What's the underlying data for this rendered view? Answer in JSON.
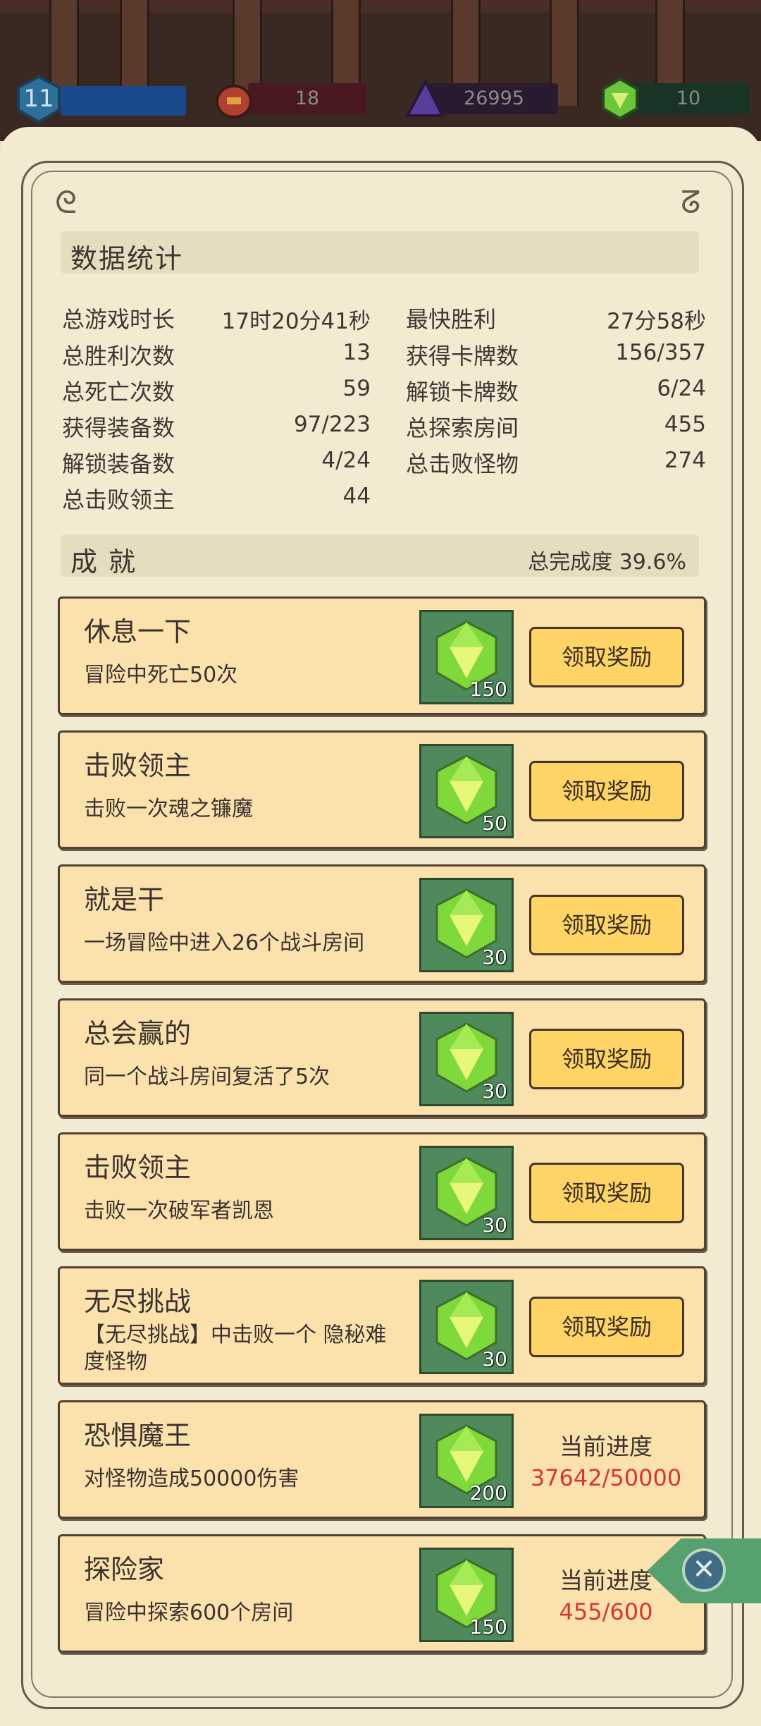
{
  "header": {
    "level": "11",
    "resources": [
      {
        "icon": "potion-icon",
        "value": "18",
        "bar_color": "#4a1820"
      },
      {
        "icon": "purple-crystal-icon",
        "value": "26995",
        "bar_color": "#2a1a30"
      },
      {
        "icon": "green-gem-icon",
        "value": "10",
        "bar_color": "#183424"
      }
    ]
  },
  "stats": {
    "title": "数据统计",
    "left": [
      {
        "label": "总游戏时长",
        "value": "17时20分41秒"
      },
      {
        "label": "总胜利次数",
        "value": "13"
      },
      {
        "label": "总死亡次数",
        "value": "59"
      },
      {
        "label": "获得装备数",
        "value": "97/223"
      },
      {
        "label": "解锁装备数",
        "value": "4/24"
      },
      {
        "label": "总击败领主",
        "value": "44"
      }
    ],
    "right": [
      {
        "label": "最快胜利",
        "value": "27分58秒"
      },
      {
        "label": "获得卡牌数",
        "value": "156/357"
      },
      {
        "label": "解锁卡牌数",
        "value": "6/24"
      },
      {
        "label": "总探索房间",
        "value": "455"
      },
      {
        "label": "总击败怪物",
        "value": "274"
      }
    ]
  },
  "achievements": {
    "title": "成 就",
    "completion": "总完成度  39.6%",
    "claim_label": "领取奖励",
    "progress_label": "当前进度",
    "items": [
      {
        "title": "休息一下",
        "desc": "冒险中死亡50次",
        "reward": "150"
      },
      {
        "title": "击败领主",
        "desc": "击败一次魂之镰魔",
        "reward": "50"
      },
      {
        "title": "就是干",
        "desc": "一场冒险中进入26个战斗房间",
        "reward": "30"
      },
      {
        "title": "总会赢的",
        "desc": "同一个战斗房间复活了5次",
        "reward": "30"
      },
      {
        "title": "击败领主",
        "desc": "击败一次破军者凯恩",
        "reward": "30"
      },
      {
        "title": "无尽挑战",
        "desc": "【无尽挑战】中击败一个 隐秘难度怪物",
        "reward": "30"
      },
      {
        "title": "恐惧魔王",
        "desc": "对怪物造成50000伤害",
        "reward": "200",
        "progress": "37642/50000"
      },
      {
        "title": "探险家",
        "desc": "冒险中探索600个房间",
        "reward": "150",
        "progress": "455/600"
      }
    ]
  },
  "colors": {
    "accent_red": "#d6363a",
    "button_yellow": "#ffd466",
    "card_bg": "#fbe2ad",
    "gem_tile": "#4f8a5c"
  }
}
